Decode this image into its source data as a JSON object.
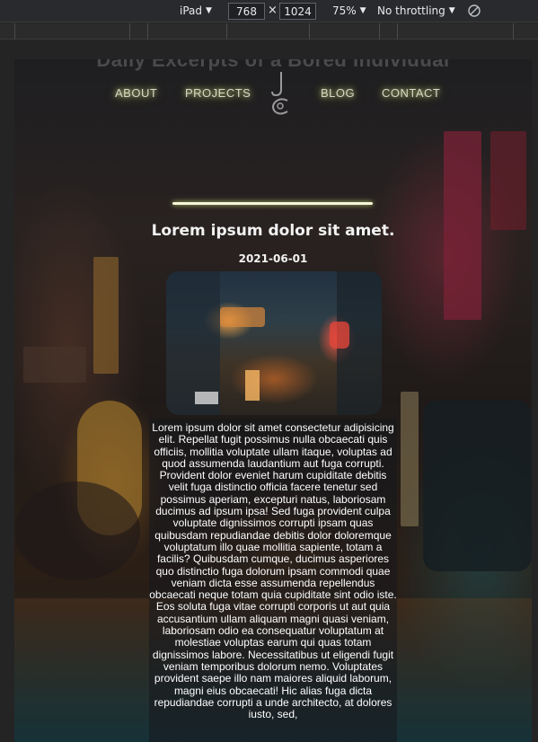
{
  "devtools": {
    "device": "iPad",
    "width": "768",
    "height": "1024",
    "times_symbol": "×",
    "zoom": "75%",
    "throttling": "No throttling"
  },
  "site": {
    "ghost_title": "Daily Excerpts of a Bored Individual",
    "nav": {
      "about": "ABOUT",
      "projects": "PROJECTS",
      "blog": "BLOG",
      "contact": "CONTACT"
    },
    "logo_text": "JC",
    "accent": "#e6f27a"
  },
  "post": {
    "title": "Lorem ipsum dolor sit amet.",
    "date": "2021-06-01",
    "image_alt": "Night city alley",
    "body": "Lorem ipsum dolor sit amet consectetur adipisicing elit. Repellat fugit possimus nulla obcaecati quis officiis, mollitia voluptate ullam itaque, voluptas ad quod assumenda laudantium aut fuga corrupti. Provident dolor eveniet harum cupiditate debitis velit fuga distinctio officia facere tenetur sed possimus aperiam, excepturi natus, laboriosam ducimus ad ipsum ipsa! Sed fuga provident culpa voluptate dignissimos corrupti ipsam quas quibusdam repudiandae debitis dolor doloremque voluptatum illo quae mollitia sapiente, totam a facilis? Quibusdam cumque, ducimus asperiores quo distinctio fuga dolorum ipsam commodi quae veniam dicta esse assumenda repellendus obcaecati neque totam quia cupiditate sint odio iste. Eos soluta fuga vitae corrupti corporis ut aut quia accusantium ullam aliquam magni quasi veniam, laboriosam odio ea consequatur voluptatum at molestiae voluptas earum qui quas totam dignissimos labore. Necessitatibus ut eligendi fugit veniam temporibus dolorum nemo. Voluptates provident saepe illo nam maiores aliquid laborum, magni eius obcaecati! Hic alias fuga dicta repudiandae corrupti a unde architecto, at dolores iusto, sed,"
  }
}
